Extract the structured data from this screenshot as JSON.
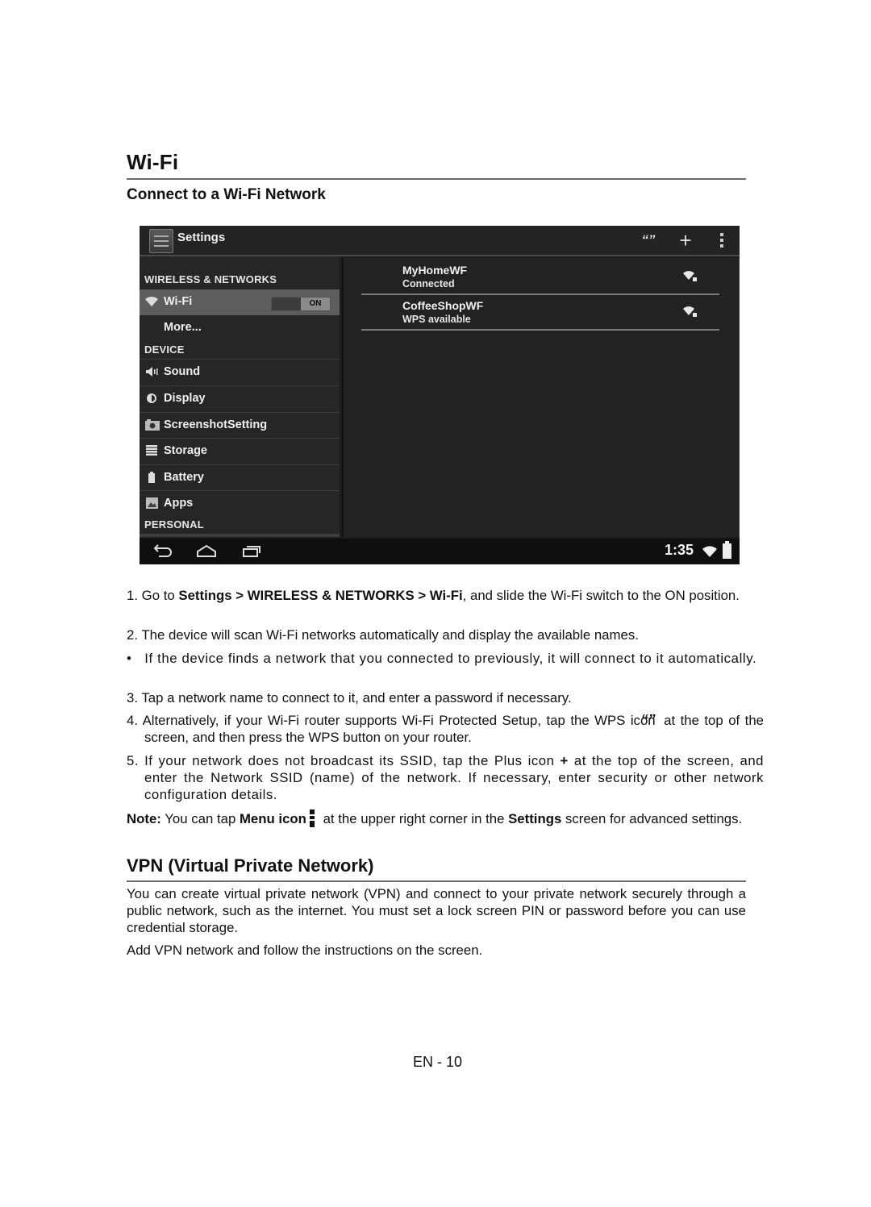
{
  "document": {
    "section_title": "Wi-Fi",
    "subsection_title": "Connect to a Wi-Fi Network",
    "page_footer": "EN - 10"
  },
  "device": {
    "action_bar": {
      "title": "Settings",
      "icons": [
        "settings-app-icon",
        "wps-icon",
        "plus-icon",
        "menu-icon"
      ],
      "plus_glyph": "+"
    },
    "sidebar": {
      "headers": [
        "WIRELESS & NETWORKS",
        "DEVICE",
        "PERSONAL"
      ],
      "items": [
        {
          "label": "Wi-Fi",
          "icon": "wifi-icon",
          "active": true,
          "toggle": "ON"
        },
        {
          "label": "More...",
          "icon": ""
        },
        {
          "label": "Sound",
          "icon": "speaker-icon"
        },
        {
          "label": "Display",
          "icon": "brightness-icon"
        },
        {
          "label": "ScreenshotSetting",
          "icon": "camera-icon"
        },
        {
          "label": "Storage",
          "icon": "storage-icon"
        },
        {
          "label": "Battery",
          "icon": "battery-icon"
        },
        {
          "label": "Apps",
          "icon": "apps-icon"
        }
      ]
    },
    "networks": [
      {
        "name": "MyHomeWF",
        "status": "Connected",
        "icon": "wifi-lock-signal-icon"
      },
      {
        "name": "CoffeeShopWF",
        "status": "WPS available",
        "icon": "wifi-lock-signal-icon"
      }
    ],
    "nav_bar": {
      "buttons": [
        "back-icon",
        "home-icon",
        "recent-apps-icon"
      ],
      "clock": "1:35",
      "status_icons": [
        "wifi-icon",
        "battery-icon"
      ]
    }
  },
  "steps": {
    "s1": {
      "num": "1.",
      "pre": "Go to ",
      "b1": "Settings > WIRELESS & NETWORKS > Wi-Fi",
      "post": ", and slide the Wi-Fi switch to the ON position."
    },
    "s2": {
      "num": "2.",
      "text": "The device will scan Wi-Fi networks automatically and display the available names."
    },
    "bullet": {
      "num": "•",
      "text": "If the device finds a network that you connected to previously, it will connect to it automatically."
    },
    "s3": {
      "num": "3.",
      "text": "Tap a network name to connect to it, and enter a password if necessary."
    },
    "s4": {
      "num": "4.",
      "pre": "Alternatively, if your Wi-Fi router supports Wi-Fi Protected Setup, tap the WPS icon",
      "post": "at the top of the screen, and then press the WPS button on your router."
    },
    "s5": {
      "num": "5.",
      "pre": "If your network does not broadcast its SSID, tap the Plus icon ",
      "plus": "+",
      "post": " at the top of the screen, and enter the Network SSID (name) of the network. If necessary, enter security or other network configuration details."
    }
  },
  "note": {
    "label": "Note:",
    "pre": " You can tap ",
    "b1": "Menu icon",
    "mid": " at the upper right corner in the ",
    "b2": "Settings",
    "post": " screen for advanced settings."
  },
  "vpn": {
    "title": "VPN (Virtual Private Network)",
    "p1": "You can create virtual private network (VPN) and connect to your private network securely through a public network, such as the internet. You must set a lock screen PIN or password before you can use credential storage.",
    "p2": "Add VPN network and follow the instructions on the screen."
  }
}
